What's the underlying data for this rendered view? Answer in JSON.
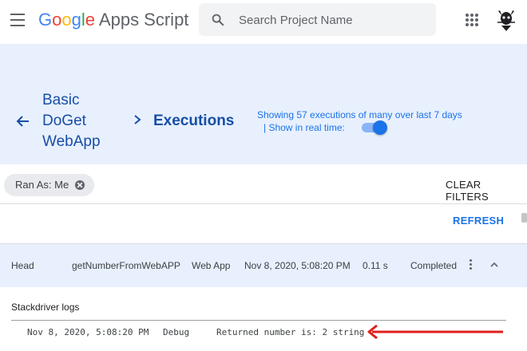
{
  "header": {
    "logo_letters": [
      "G",
      "o",
      "o",
      "g",
      "l",
      "e"
    ],
    "logo_rest": "Apps Script",
    "search_placeholder": "Search Project Name"
  },
  "banner": {
    "project_name": [
      "Basic",
      "DoGet",
      "WebApp"
    ],
    "section_title": "Executions",
    "showing_text": "Showing 57 executions of many over last 7 days",
    "realtime_text": "|  Show in real time:",
    "realtime_enabled": true
  },
  "filters": {
    "chip_label": "Ran As: Me",
    "clear_label": "CLEAR FILTERS"
  },
  "refresh_label": "REFRESH",
  "execution": {
    "deployment": "Head",
    "function": "getNumberFromWebAPP",
    "type": "Web App",
    "started": "Nov 8, 2020, 5:08:20 PM",
    "duration": "0.11 s",
    "status": "Completed"
  },
  "logs": {
    "title": "Stackdriver logs",
    "entries": [
      {
        "time": "Nov 8, 2020, 5:08:20 PM",
        "level": "Debug",
        "message": "Returned number is: 2 string"
      }
    ]
  },
  "colors": {
    "accent": "#1a73e8",
    "banner": "#e8f0fe",
    "arrow": "#e0201c"
  }
}
